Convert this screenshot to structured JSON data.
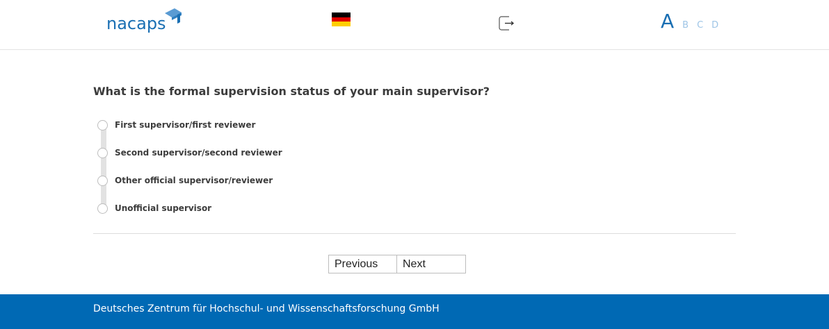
{
  "header": {
    "logo_text": "nacaps",
    "language_flag": "germany-flag",
    "logout_icon": "logout-icon",
    "font_sizes": [
      "A",
      "B",
      "C",
      "D"
    ]
  },
  "colors": {
    "brand_blue": "#0069b4",
    "logo_blue": "#1a6fb3",
    "font_size_inactive": "#9ec5e6"
  },
  "survey": {
    "question": "What is the formal supervision status of your main supervisor?",
    "options": [
      {
        "label": "First supervisor/first reviewer",
        "selected": false
      },
      {
        "label": "Second supervisor/second reviewer",
        "selected": false
      },
      {
        "label": "Other official supervisor/reviewer",
        "selected": false
      },
      {
        "label": "Unofficial supervisor",
        "selected": false
      }
    ]
  },
  "navigation": {
    "previous_label": "Previous",
    "next_label": "Next"
  },
  "footer": {
    "text": "Deutsches Zentrum für Hochschul- und Wissenschaftsforschung GmbH"
  }
}
